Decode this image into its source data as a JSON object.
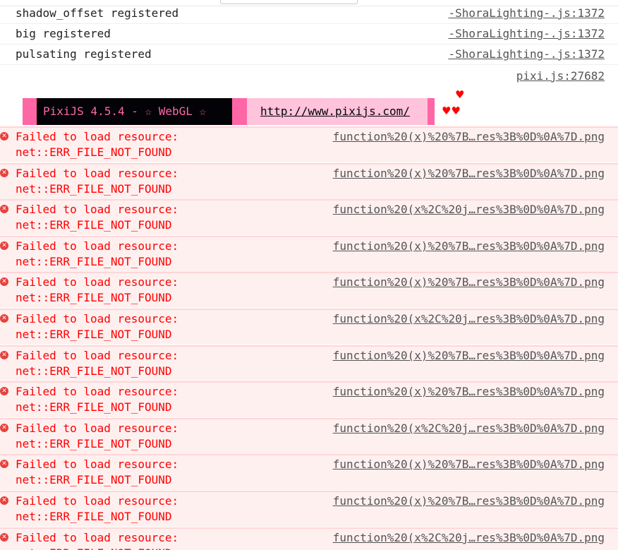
{
  "log_rows": [
    {
      "message": "shadow_offset registered",
      "source": "-ShoraLighting-.js:1372"
    },
    {
      "message": "big registered",
      "source": "-ShoraLighting-.js:1372"
    },
    {
      "message": "pulsating registered",
      "source": "-ShoraLighting-.js:1372"
    }
  ],
  "pixi_source": "pixi.js:27682",
  "banner": {
    "title": "PixiJS 4.5.4 - ☆ WebGL ☆",
    "link": "http://www.pixijs.com/",
    "heart_top": "♥",
    "hearts_bottom": "♥♥",
    "colors": {
      "pink": "#ff66a5",
      "dark": "#030307",
      "light": "#ffc3dc",
      "heart": "#ff0000"
    }
  },
  "errors": {
    "icon": "error-icon",
    "line1": "Failed to load resource:",
    "line2": "net::ERR_FILE_NOT_FOUND",
    "items": [
      {
        "source": "function%20(x)%20%7B…res%3B%0D%0A%7D.png"
      },
      {
        "source": "function%20(x)%20%7B…res%3B%0D%0A%7D.png"
      },
      {
        "source": "function%20(x%2C%20j…res%3B%0D%0A%7D.png"
      },
      {
        "source": "function%20(x)%20%7B…res%3B%0D%0A%7D.png"
      },
      {
        "source": "function%20(x)%20%7B…res%3B%0D%0A%7D.png"
      },
      {
        "source": "function%20(x%2C%20j…res%3B%0D%0A%7D.png"
      },
      {
        "source": "function%20(x)%20%7B…res%3B%0D%0A%7D.png"
      },
      {
        "source": "function%20(x)%20%7B…res%3B%0D%0A%7D.png"
      },
      {
        "source": "function%20(x%2C%20j…res%3B%0D%0A%7D.png"
      },
      {
        "source": "function%20(x)%20%7B…res%3B%0D%0A%7D.png"
      },
      {
        "source": "function%20(x)%20%7B…res%3B%0D%0A%7D.png"
      },
      {
        "source": "function%20(x%2C%20j…res%3B%0D%0A%7D.png"
      }
    ],
    "colors": {
      "text": "#ff0000",
      "background": "#fff0f0",
      "border": "#ffd6d6"
    }
  }
}
